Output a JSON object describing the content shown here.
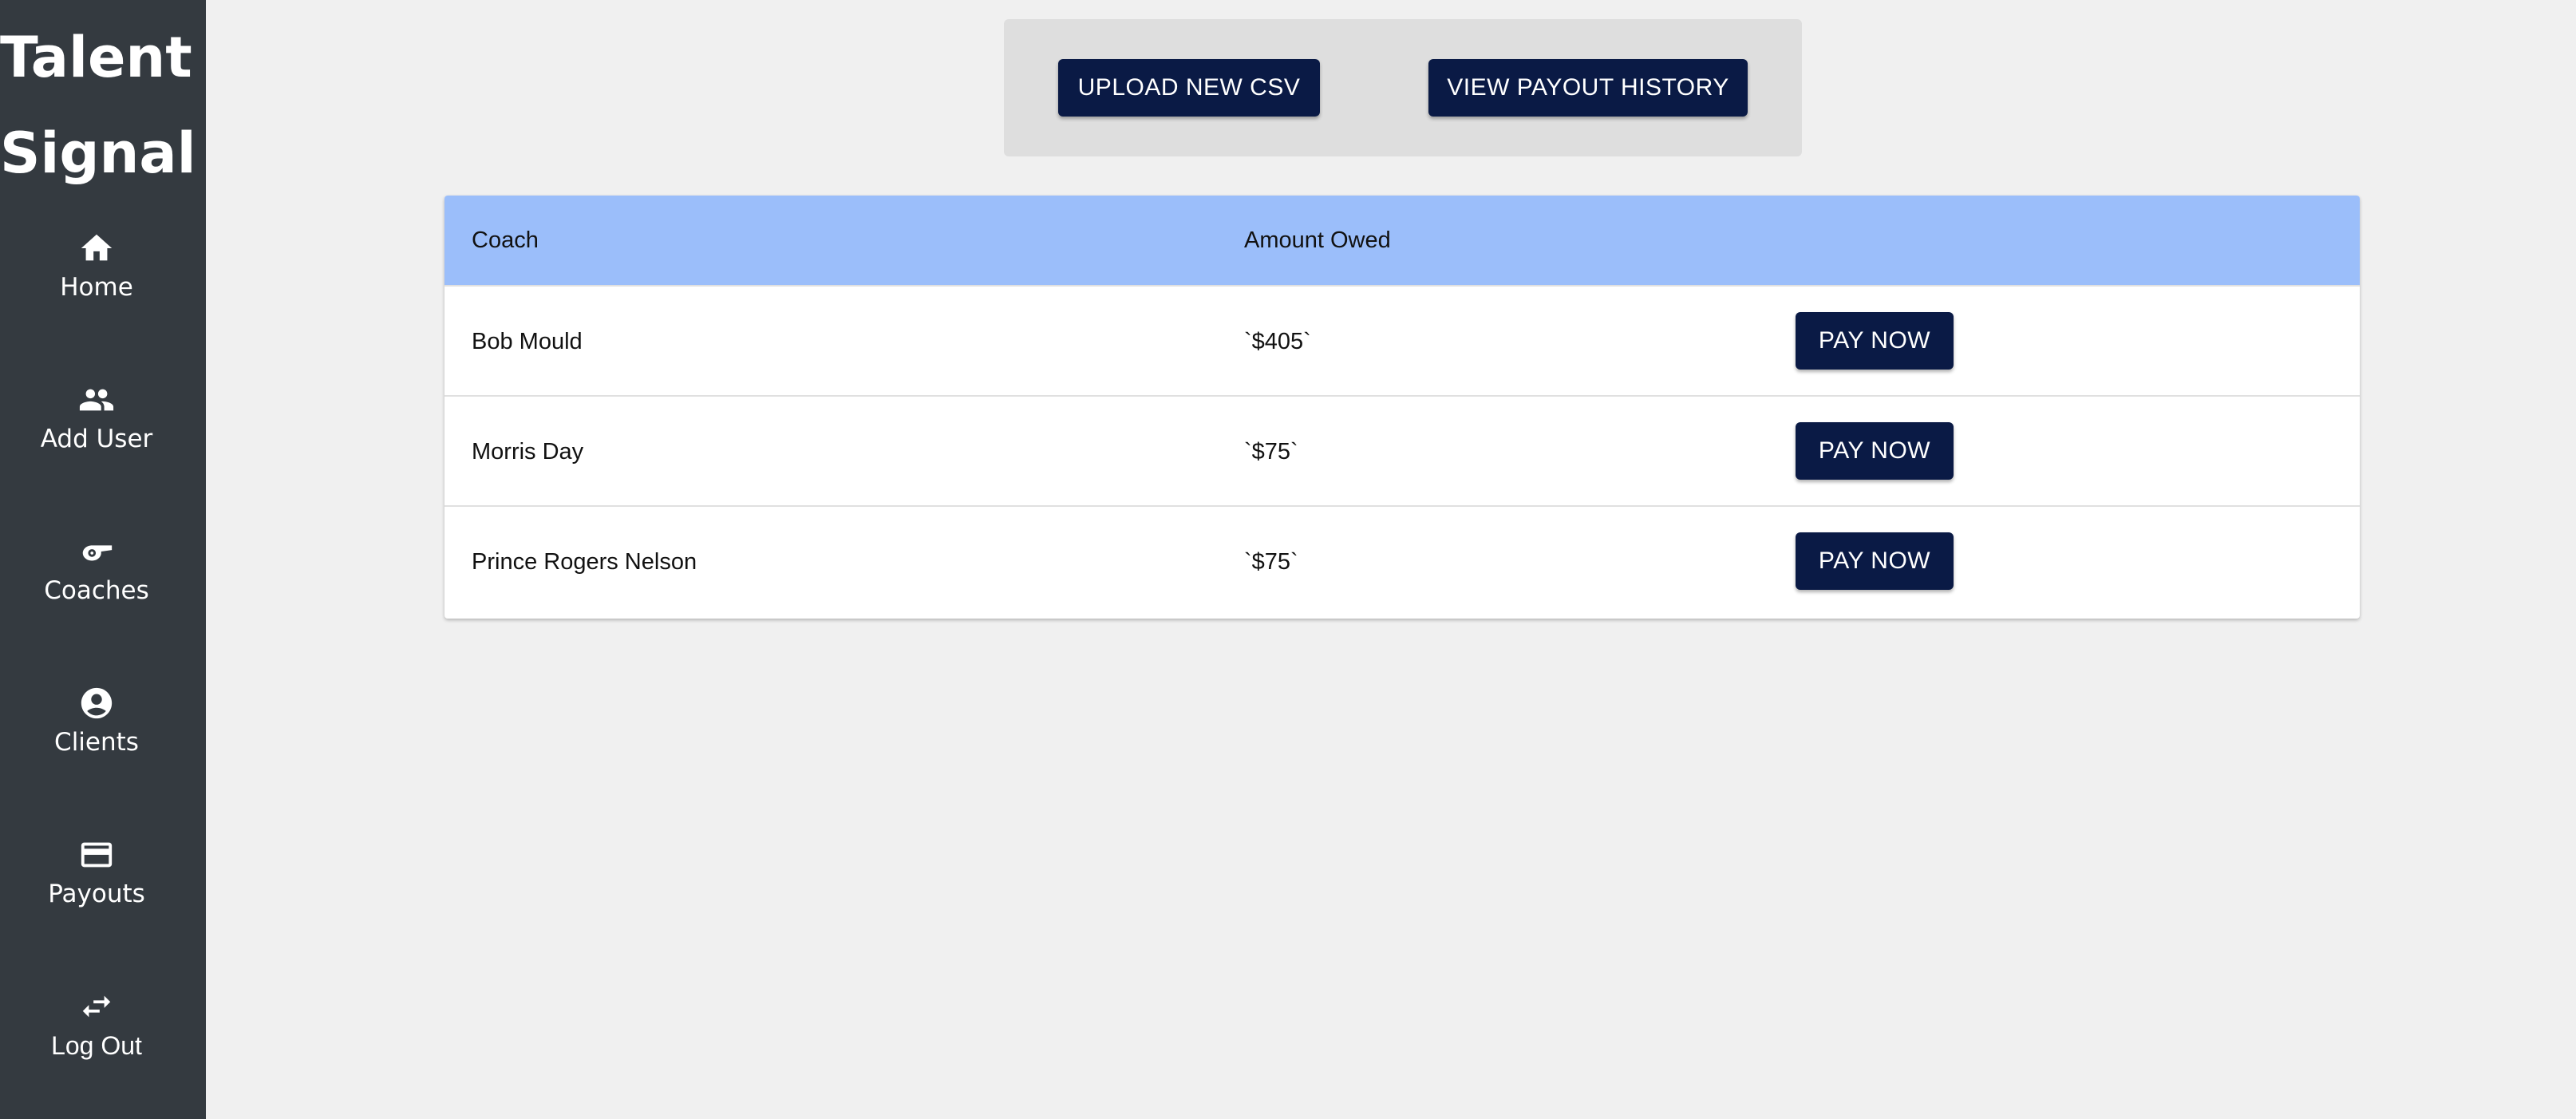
{
  "brand": {
    "line1": "Talent",
    "line2": "Signal"
  },
  "sidebar": {
    "items": [
      {
        "label": "Home",
        "icon": "home-icon"
      },
      {
        "label": "Add User",
        "icon": "people-icon"
      },
      {
        "label": "Coaches",
        "icon": "whistle-icon"
      },
      {
        "label": "Clients",
        "icon": "account-circle-icon"
      },
      {
        "label": "Payouts",
        "icon": "credit-card-icon"
      },
      {
        "label": "Log Out",
        "icon": "swap-arrows-icon"
      }
    ]
  },
  "actions": {
    "upload_label": "UPLOAD NEW CSV",
    "history_label": "VIEW PAYOUT HISTORY"
  },
  "table": {
    "columns": [
      "Coach",
      "Amount Owed",
      ""
    ],
    "rows": [
      {
        "coach": "Bob Mould",
        "amount": "`$405`",
        "action": "PAY NOW"
      },
      {
        "coach": "Morris Day",
        "amount": "`$75`",
        "action": "PAY NOW"
      },
      {
        "coach": "Prince Rogers Nelson",
        "amount": "`$75`",
        "action": "PAY NOW"
      }
    ]
  },
  "colors": {
    "sidebar_bg": "#343a40",
    "button_bg": "#0a1a45",
    "table_header_bg": "#9bbefa",
    "page_bg": "#f0f0f0"
  }
}
